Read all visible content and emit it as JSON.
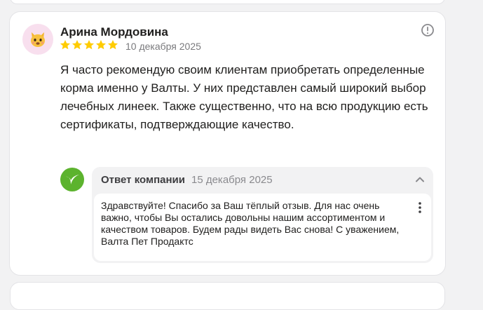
{
  "review": {
    "author": "Арина Мордовина",
    "avatar_icon": "cat-emoji-icon",
    "rating": 5,
    "date": "10 декабря 2025",
    "text": "Я часто рекомендую своим клиентам приобретать определенные корма именно у Валты. У них представлен самый широкий выбор лечебных линеек. Также существенно, что на всю продукцию есть сертификаты, подтверждающие качество.",
    "report_icon": "exclamation-circle-icon"
  },
  "reply": {
    "title": "Ответ компании",
    "date": "15 декабря 2025",
    "text": "Здравствуйте! Спасибо за Ваш тёплый отзыв. Для нас очень важно, чтобы Вы остались довольны нашим ассортиментом и качеством товаров. Будем рады видеть Вас снова! С уважением, Валта Пет Продактс",
    "logo_icon": "company-logo-icon",
    "collapse_icon": "chevron-up-icon",
    "more_icon": "more-vertical-icon"
  },
  "colors": {
    "star": "#fc0",
    "logo_green": "#5cb32e",
    "avatar_bg": "#f8dfee"
  }
}
